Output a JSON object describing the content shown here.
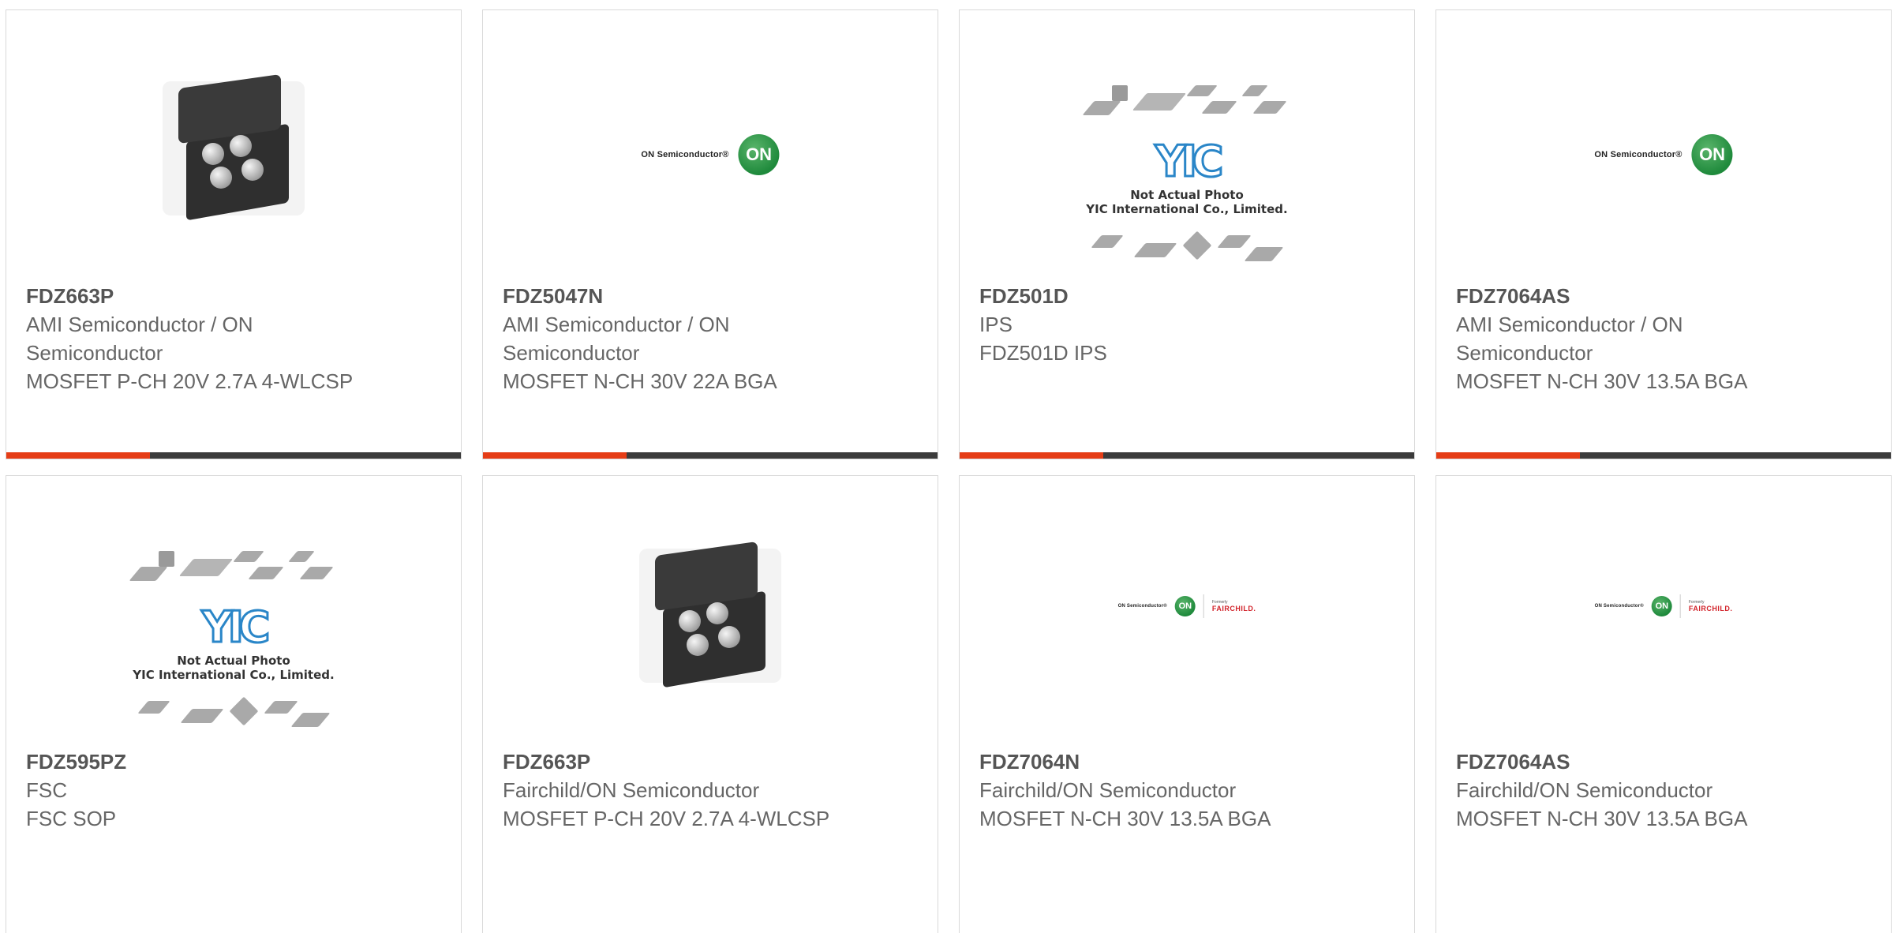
{
  "products": [
    {
      "part": "FDZ663P",
      "manufacturer": "AMI Semiconductor / ON Semiconductor",
      "description": "MOSFET P-CH 20V 2.7A 4-WLCSP",
      "image": "chip-photo-icon"
    },
    {
      "part": "FDZ5047N",
      "manufacturer": "AMI Semiconductor / ON Semiconductor",
      "description": "MOSFET N-CH 30V 22A BGA",
      "image": "on-semiconductor-logo",
      "logo_text": "ON Semiconductor®",
      "logo_mark": "ON"
    },
    {
      "part": "FDZ501D",
      "manufacturer": "IPS",
      "description": "FDZ501D IPS",
      "image": "yic-placeholder",
      "yic": "YIC",
      "note_line1": "Not Actual Photo",
      "note_line2": "YIC International Co., Limited."
    },
    {
      "part": "FDZ7064AS",
      "manufacturer": "AMI Semiconductor / ON Semiconductor",
      "description": "MOSFET N-CH 30V 13.5A BGA",
      "image": "on-semiconductor-logo",
      "logo_text": "ON Semiconductor®",
      "logo_mark": "ON"
    },
    {
      "part": "FDZ595PZ",
      "manufacturer": "FSC",
      "description": "FSC SOP",
      "image": "yic-placeholder",
      "yic": "YIC",
      "note_line1": "Not Actual Photo",
      "note_line2": "YIC International Co., Limited."
    },
    {
      "part": "FDZ663P",
      "manufacturer": "Fairchild/ON Semiconductor",
      "description": "MOSFET P-CH 20V 2.7A 4-WLCSP",
      "image": "chip-photo-icon"
    },
    {
      "part": "FDZ7064N",
      "manufacturer": "Fairchild/ON Semiconductor",
      "description": "MOSFET N-CH 30V 13.5A BGA",
      "image": "on-fairchild-logo",
      "logo_text": "ON Semiconductor®",
      "logo_mark": "ON",
      "formerly": "Formerly",
      "fairchild": "FAIRCHILD."
    },
    {
      "part": "FDZ7064AS",
      "manufacturer": "Fairchild/ON Semiconductor",
      "description": "MOSFET N-CH 30V 13.5A BGA",
      "image": "on-fairchild-logo",
      "logo_text": "ON Semiconductor®",
      "logo_mark": "ON",
      "formerly": "Formerly",
      "fairchild": "FAIRCHILD."
    }
  ],
  "colors": {
    "accent": "#e53d16",
    "bar": "#3b3b3b",
    "border": "#d9d9d9",
    "text": "#666666",
    "on_green": "#1f8a3c",
    "yic_blue": "#2a86c8"
  }
}
